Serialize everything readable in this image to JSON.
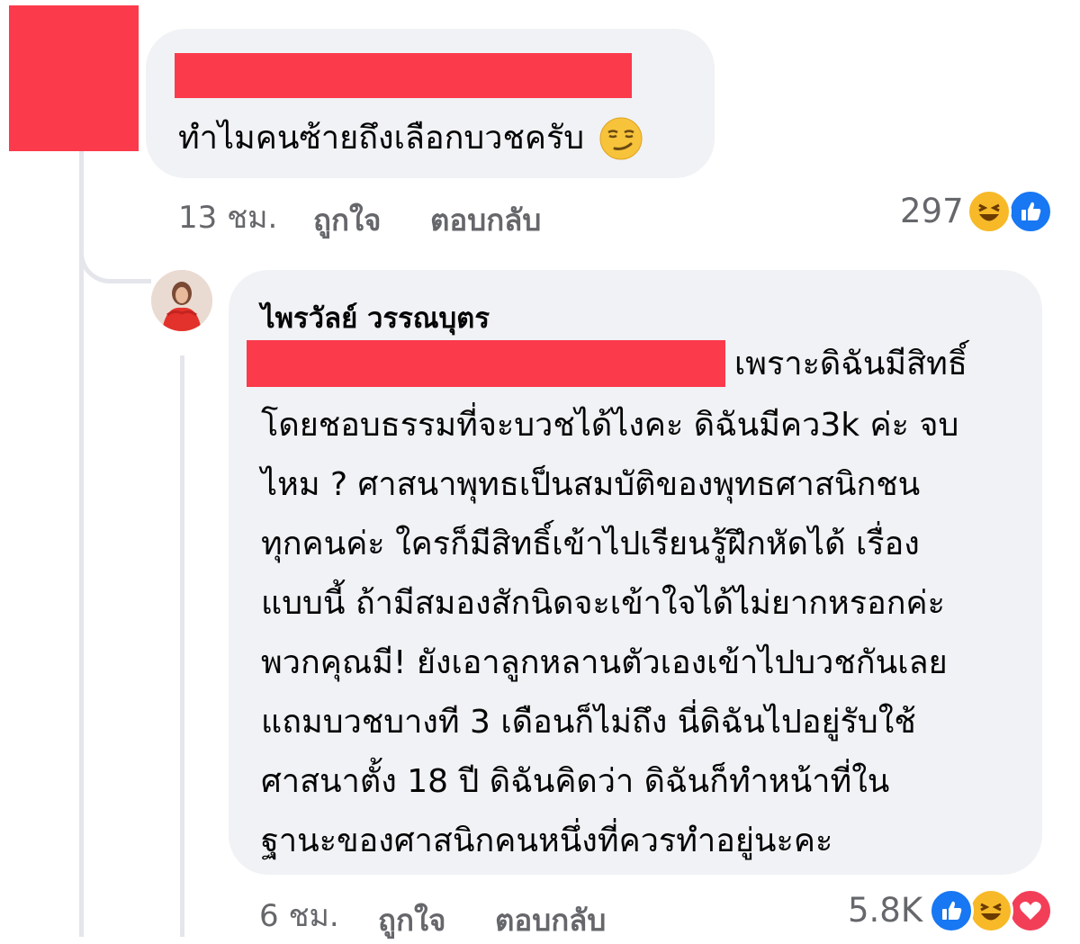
{
  "comment1": {
    "text": "ทำไมคนซ้ายถึงเลือกบวชครับ",
    "emoji_icon": "smirk-emoji-icon",
    "time": "13 ชม.",
    "like_label": "ถูกใจ",
    "reply_label": "ตอบกลับ",
    "reaction_count": "297",
    "reactions": [
      "haha-reaction-icon",
      "like-reaction-icon"
    ]
  },
  "reply": {
    "author": "ไพรวัลย์ วรรณบุตร",
    "lines": [
      "เพราะดิฉันมีสิทธิ์",
      "โดยชอบธรรมที่จะบวชได้ไงคะ ดิฉันมีคว3k ค่ะ จบ",
      "ไหม ? ศาสนาพุทธเป็นสมบัติของพุทธศาสนิกชน",
      "ทุกคนค่ะ ใครก็มีสิทธิ์เข้าไปเรียนรู้ฝึกหัดได้ เรื่อง",
      "แบบนี้ ถ้ามีสมองสักนิดจะเข้าใจได้ไม่ยากหรอกค่ะ",
      "พวกคุณมี! ยังเอาลูกหลานตัวเองเข้าไปบวชกันเลย",
      "แถมบวชบางที 3 เดือนก็ไม่ถึง นี่ดิฉันไปอยู่รับใช้",
      "ศาสนาตั้ง 18 ปี ดิฉันคิดว่า ดิฉันก็ทำหน้าที่ใน",
      "ฐานะของศาสนิกคนหนึ่งที่ควรทำอยู่นะคะ"
    ],
    "time": "6 ชม.",
    "like_label": "ถูกใจ",
    "reply_label": "ตอบกลับ",
    "reaction_count": "5.8K",
    "reactions": [
      "like-reaction-icon",
      "haha-reaction-icon",
      "love-reaction-icon"
    ]
  },
  "colors": {
    "redaction": "#fb3a4c",
    "bubble": "#f0f2f5",
    "meta_text": "#65676b",
    "like_blue": "#1877f2",
    "haha_yellow": "#f7b928",
    "love_red": "#f33e58"
  }
}
